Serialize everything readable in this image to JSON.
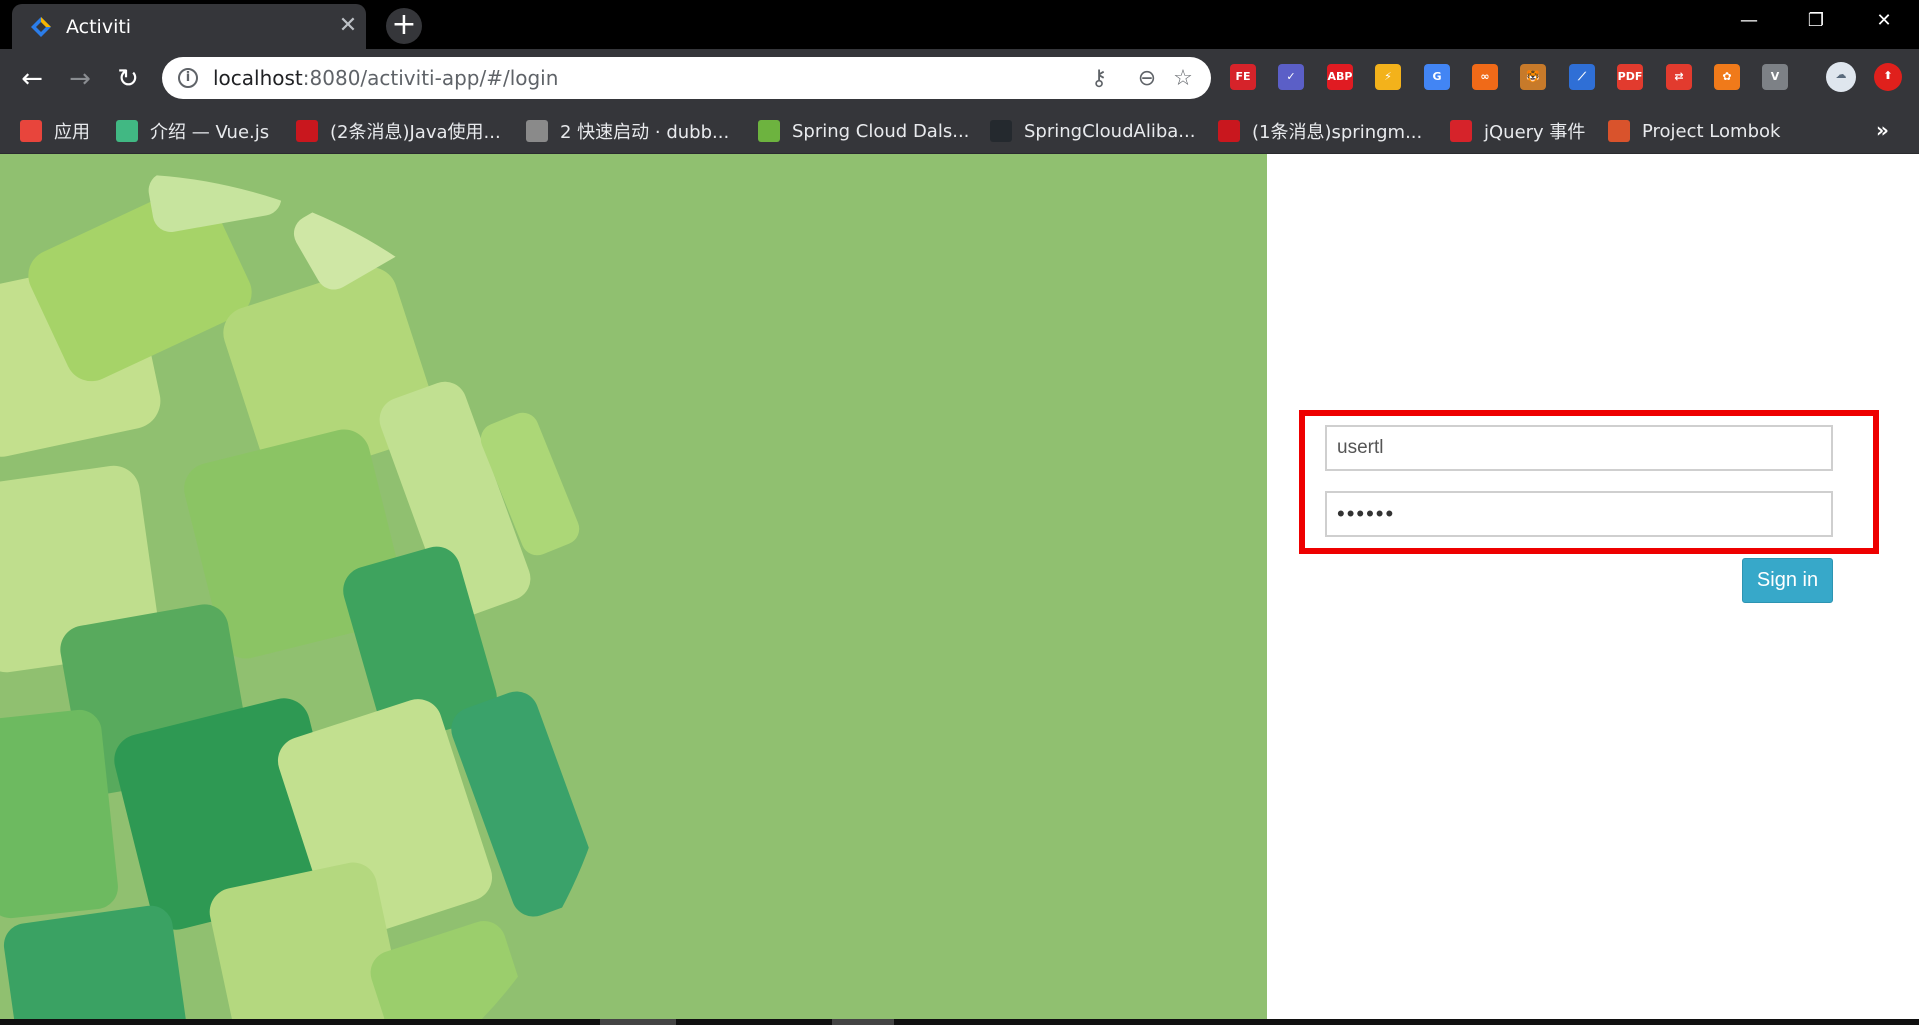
{
  "browser": {
    "tab": {
      "title": "Activiti",
      "close_glyph": "✕"
    },
    "new_tab_glyph": "+",
    "window_controls": {
      "minimize": "—",
      "restore": "❐",
      "close": "✕"
    },
    "omnibox": {
      "host": "localhost",
      "path": ":8080/activiti-app/#/login"
    },
    "extensions": [
      {
        "label": "FE",
        "color": "#d6232a"
      },
      {
        "label": "✓",
        "color": "#5b5fc7"
      },
      {
        "label": "ABP",
        "color": "#e01b22"
      },
      {
        "label": "⚡",
        "color": "#f3b21b"
      },
      {
        "label": "G",
        "color": "#4285f4"
      },
      {
        "label": "∞",
        "color": "#f06a18"
      },
      {
        "label": "🐯",
        "color": "#c77a2a"
      },
      {
        "label": "⟋",
        "color": "#2f6fd6"
      },
      {
        "label": "PDF",
        "color": "#e23b2e"
      },
      {
        "label": "⇄",
        "color": "#e23b2e"
      },
      {
        "label": "✿",
        "color": "#f07a1a"
      },
      {
        "label": "V",
        "color": "#7d8186"
      }
    ],
    "bookmarks": [
      {
        "label": "应用",
        "icon_color": "#e8453c"
      },
      {
        "label": "介绍 — Vue.js",
        "icon_color": "#41b883"
      },
      {
        "label": "(2条消息)Java使用...",
        "icon_color": "#c9171e"
      },
      {
        "label": "2 快速启动 · dubb...",
        "icon_color": "#8a8a8a"
      },
      {
        "label": "Spring Cloud Dals...",
        "icon_color": "#6db33f"
      },
      {
        "label": "SpringCloudAliba...",
        "icon_color": "#24292e"
      },
      {
        "label": "(1条消息)springm...",
        "icon_color": "#c9171e"
      },
      {
        "label": "jQuery 事件",
        "icon_color": "#d6232a"
      },
      {
        "label": "Project Lombok",
        "icon_color": "#d9532c"
      }
    ],
    "bookmarks_overflow": "»"
  },
  "login": {
    "username_value": "usertl",
    "password_value": "••••••",
    "signin_label": "Sign in"
  }
}
